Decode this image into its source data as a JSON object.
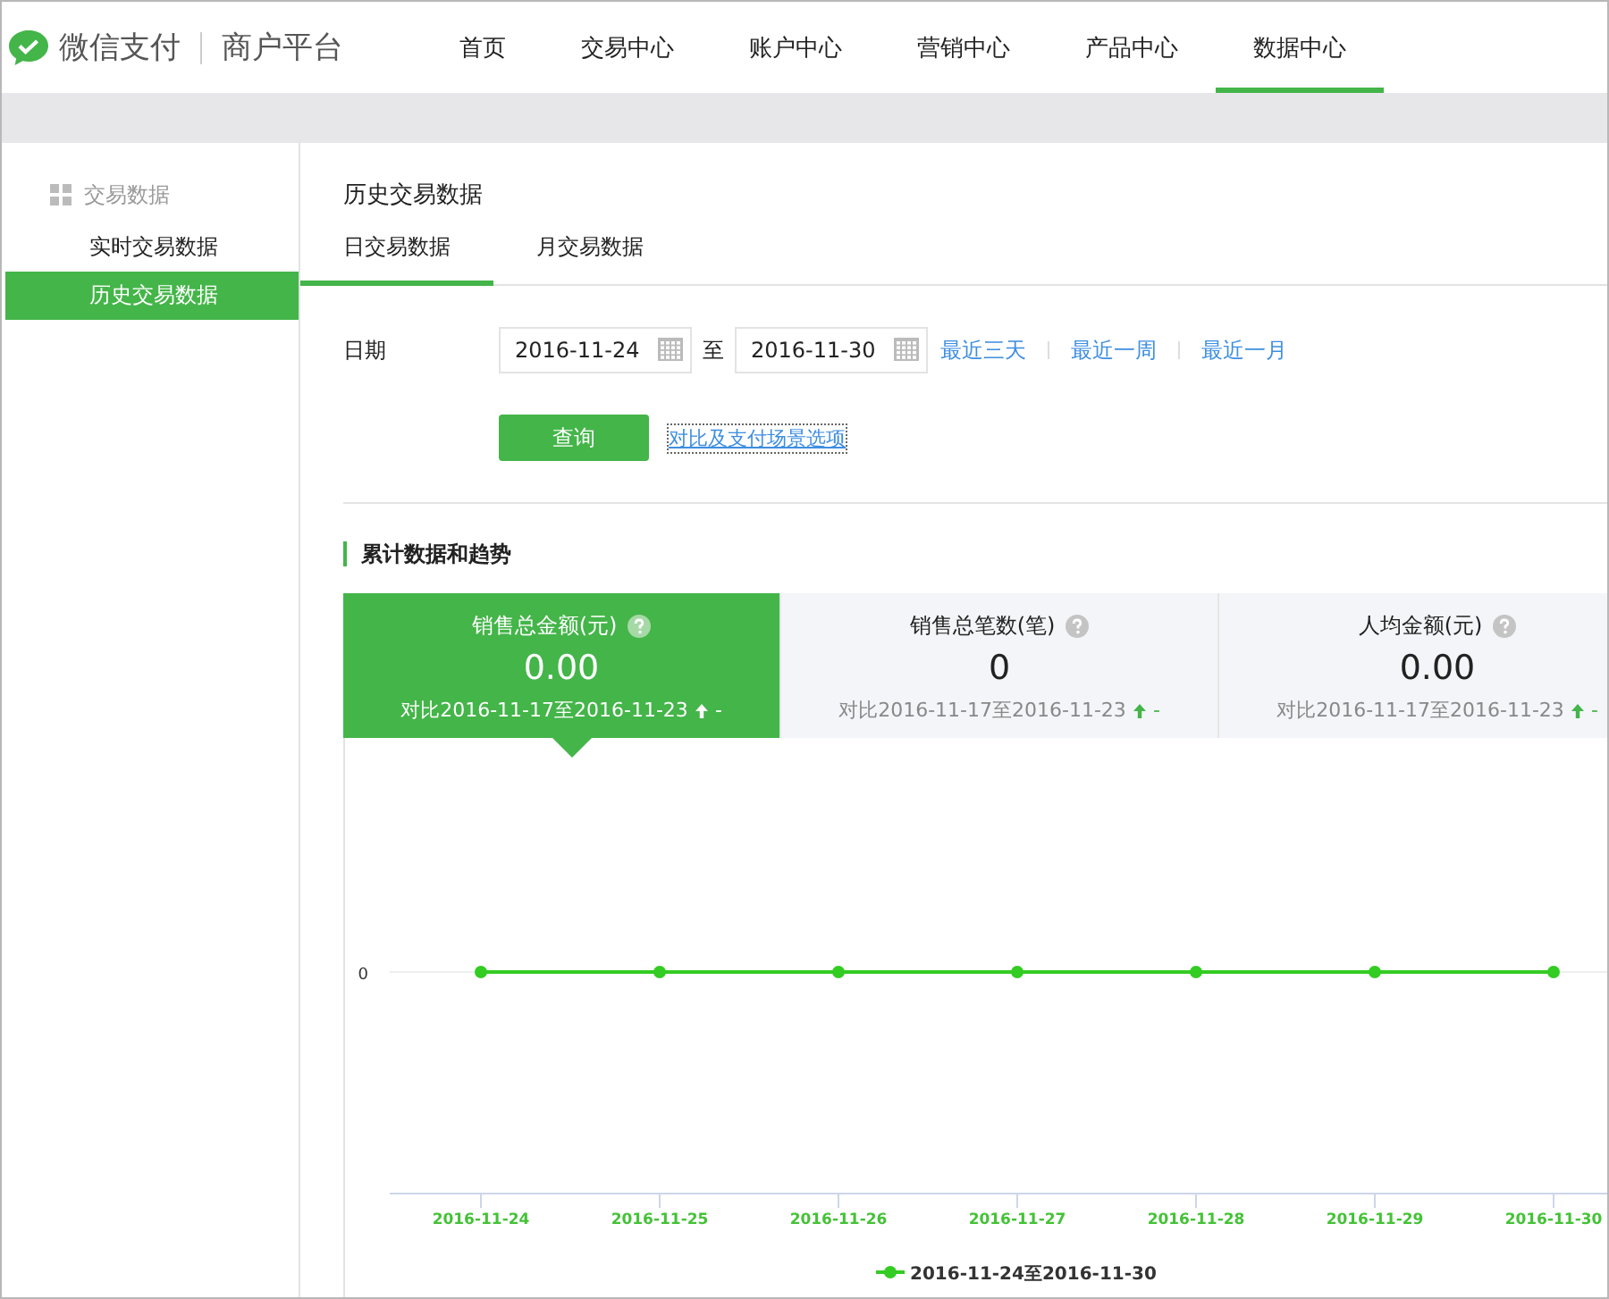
{
  "brand": {
    "name": "微信支付",
    "product": "商户平台"
  },
  "nav": [
    {
      "label": "首页",
      "selected": false
    },
    {
      "label": "交易中心",
      "selected": false
    },
    {
      "label": "账户中心",
      "selected": false
    },
    {
      "label": "营销中心",
      "selected": false
    },
    {
      "label": "产品中心",
      "selected": false
    },
    {
      "label": "数据中心",
      "selected": true
    }
  ],
  "sidebar": {
    "group": "交易数据",
    "items": [
      {
        "label": "实时交易数据",
        "selected": false
      },
      {
        "label": "历史交易数据",
        "selected": true
      }
    ]
  },
  "page_title": "历史交易数据",
  "tabs": [
    {
      "label": "日交易数据",
      "selected": true
    },
    {
      "label": "月交易数据",
      "selected": false
    }
  ],
  "filter": {
    "label": "日期",
    "start": "2016-11-24",
    "separator": "至",
    "end": "2016-11-30",
    "quick_links": [
      "最近三天",
      "最近一周",
      "最近一月"
    ],
    "query_button": "查询",
    "options_link": "对比及支付场景选项"
  },
  "section_title": "累计数据和趋势",
  "metrics": [
    {
      "label": "销售总金额(元)",
      "value": "0.00",
      "compare": "对比2016-11-17至2016-11-23",
      "change": "-",
      "selected": true
    },
    {
      "label": "销售总笔数(笔)",
      "value": "0",
      "compare": "对比2016-11-17至2016-11-23",
      "change": "-",
      "selected": false
    },
    {
      "label": "人均金额(元)",
      "value": "0.00",
      "compare": "对比2016-11-17至2016-11-23",
      "change": "-",
      "selected": false
    }
  ],
  "trend_chart": {
    "y_axis_label": "0",
    "x_labels": [
      "2016-11-24",
      "2016-11-25",
      "2016-11-26",
      "2016-11-27",
      "2016-11-28",
      "2016-11-29",
      "2016-11-30"
    ],
    "legend": "2016-11-24至2016-11-30"
  }
}
